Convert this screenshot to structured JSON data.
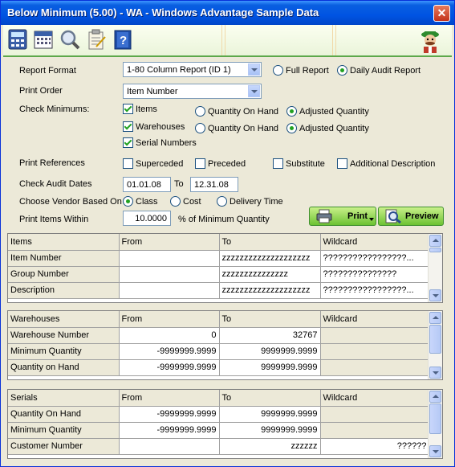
{
  "window": {
    "title": "Below Minimum (5.00) - WA - Windows Advantage Sample Data",
    "close_label": "✕"
  },
  "toolbar": {
    "icons": [
      "calculator-icon",
      "calendar-icon",
      "magnifier-icon",
      "clipboard-icon",
      "help-book-icon",
      "mascot-logo"
    ]
  },
  "form": {
    "report_format": {
      "label": "Report Format",
      "value": "1-80 Column Report (ID 1)",
      "full_report": "Full Report",
      "daily_audit": "Daily Audit Report",
      "selected": "Daily Audit Report"
    },
    "print_order": {
      "label": "Print Order",
      "value": "Item Number"
    },
    "check_minimums": {
      "label": "Check Minimums:",
      "items": "Items",
      "warehouses": "Warehouses",
      "serial_numbers": "Serial Numbers",
      "qty_on_hand": "Quantity On Hand",
      "adjusted_qty": "Adjusted Quantity",
      "items_checked": true,
      "warehouses_checked": true,
      "serials_checked": true
    },
    "print_references": {
      "label": "Print References",
      "superceded": "Superceded",
      "preceded": "Preceded",
      "substitute": "Substitute",
      "additional": "Additional Description"
    },
    "audit_dates": {
      "label": "Check Audit Dates",
      "from": "01.01.08",
      "to_label": "To",
      "to": "12.31.08"
    },
    "vendor": {
      "label": "Choose Vendor Based On",
      "class": "Class",
      "cost": "Cost",
      "delivery": "Delivery Time",
      "selected": "Class"
    },
    "print_within": {
      "label": "Print Items Within",
      "value": "10.0000",
      "suffix": "% of Minimum Quantity"
    },
    "print_button": "Print",
    "preview_button": "Preview"
  },
  "grids": {
    "items": {
      "headers": [
        "Items",
        "From",
        "To",
        "Wildcard"
      ],
      "rows": [
        [
          "Item Number",
          "",
          "zzzzzzzzzzzzzzzzzzzz",
          "?????????????????..."
        ],
        [
          "Group Number",
          "",
          "zzzzzzzzzzzzzzz",
          "???????????????"
        ],
        [
          "Description",
          "",
          "zzzzzzzzzzzzzzzzzzzz",
          "?????????????????..."
        ]
      ]
    },
    "warehouses": {
      "headers": [
        "Warehouses",
        "From",
        "To",
        "Wildcard"
      ],
      "rows": [
        [
          "Warehouse Number",
          "0",
          "32767",
          ""
        ],
        [
          "Minimum Quantity",
          "-9999999.9999",
          "9999999.9999",
          ""
        ],
        [
          "Quantity on Hand",
          "-9999999.9999",
          "9999999.9999",
          ""
        ]
      ]
    },
    "serials": {
      "headers": [
        "Serials",
        "From",
        "To",
        "Wildcard"
      ],
      "rows": [
        [
          "Quantity On Hand",
          "-9999999.9999",
          "9999999.9999",
          ""
        ],
        [
          "Minimum Quantity",
          "-9999999.9999",
          "9999999.9999",
          ""
        ],
        [
          "Customer Number",
          "",
          "zzzzzz",
          "??????"
        ]
      ]
    }
  }
}
